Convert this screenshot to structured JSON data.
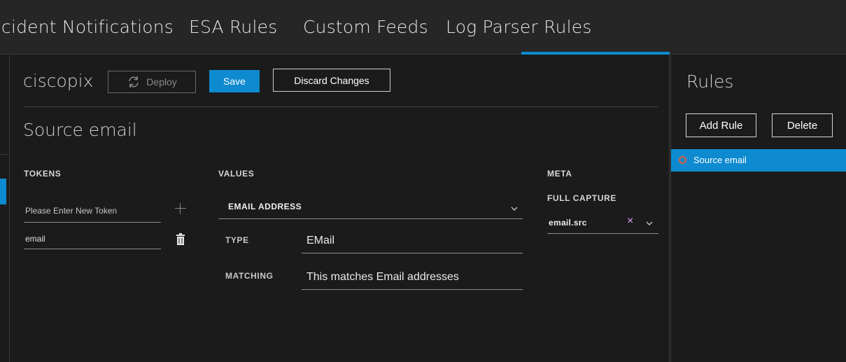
{
  "nav": {
    "tabs": [
      {
        "label": "cident Notifications"
      },
      {
        "label": "ESA Rules"
      },
      {
        "label": "Custom Feeds"
      },
      {
        "label": "Log Parser Rules",
        "active": true
      }
    ]
  },
  "parser": {
    "name": "ciscopix",
    "deploy_label": "Deploy",
    "save_label": "Save",
    "discard_label": "Discard Changes"
  },
  "rule": {
    "title": "Source email",
    "tokens": {
      "heading": "TOKENS",
      "new_placeholder": "Please Enter New Token",
      "items": [
        "email"
      ]
    },
    "values": {
      "heading": "VALUES",
      "selected": "EMAIL ADDRESS",
      "type_label": "TYPE",
      "type_value": "EMail",
      "matching_label": "MATCHING",
      "matching_value": "This matches Email addresses"
    },
    "meta": {
      "heading": "META",
      "full_capture_label": "FULL CAPTURE",
      "full_capture_value": "email.src"
    }
  },
  "rules_panel": {
    "title": "Rules",
    "add_label": "Add Rule",
    "delete_label": "Delete",
    "items": [
      {
        "label": "Source email",
        "selected": true
      }
    ]
  },
  "colors": {
    "accent": "#0e8ad0",
    "background": "#1b1b1b",
    "nav_background": "#262626"
  }
}
